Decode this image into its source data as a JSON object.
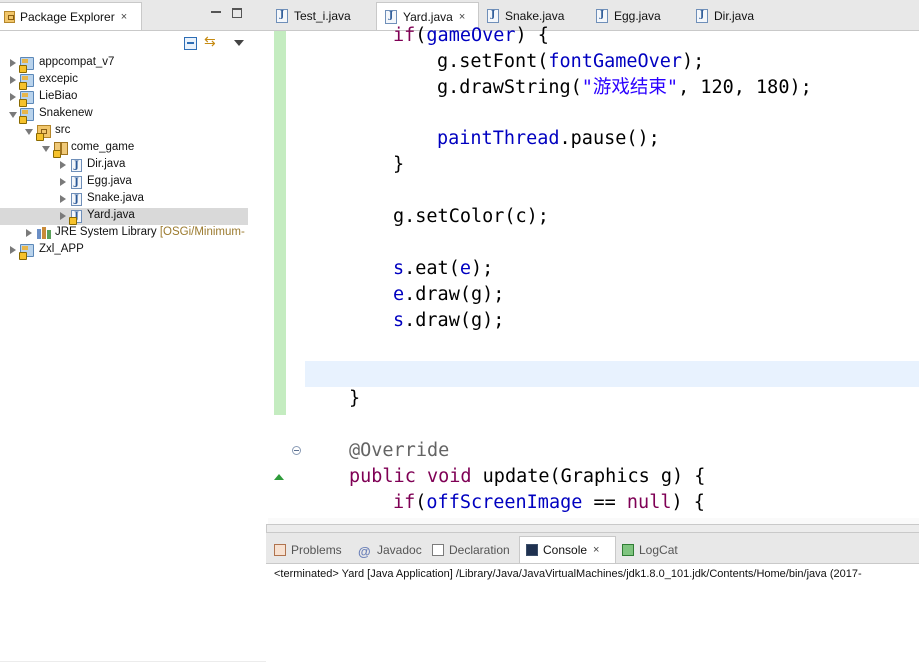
{
  "explorer": {
    "title": "Package Explorer",
    "tree": [
      {
        "label": "appcompat_v7",
        "kind": "project"
      },
      {
        "label": "excepic",
        "kind": "project"
      },
      {
        "label": "LieBiao",
        "kind": "project"
      },
      {
        "label": "Snakenew",
        "kind": "project",
        "expanded": true
      },
      {
        "label": "src",
        "kind": "source-folder",
        "expanded": true
      },
      {
        "label": "come_game",
        "kind": "package",
        "expanded": true
      },
      {
        "label": "Dir.java",
        "kind": "java"
      },
      {
        "label": "Egg.java",
        "kind": "java"
      },
      {
        "label": "Snake.java",
        "kind": "java"
      },
      {
        "label": "Yard.java",
        "kind": "java",
        "selected": true
      },
      {
        "label": "JRE System Library",
        "decoration": "[OSGi/Minimum-",
        "kind": "library"
      },
      {
        "label": "Zxl_APP",
        "kind": "project"
      }
    ]
  },
  "editor": {
    "tabs": [
      {
        "label": "Test_i.java",
        "active": false
      },
      {
        "label": "Yard.java",
        "active": true
      },
      {
        "label": "Snake.java",
        "active": false
      },
      {
        "label": "Egg.java",
        "active": false
      },
      {
        "label": "Dir.java",
        "active": false
      }
    ],
    "code": {
      "l1_kw": "if",
      "l1_p": "(",
      "l1_f": "gameOver",
      "l1_e": ") {",
      "l2_a": "g.setFont(",
      "l2_f": "fontGameOver",
      "l2_e": ");",
      "l3_a": "g.drawString(",
      "l3_s": "\"游戏结束\"",
      "l3_e": ", 120, 180);",
      "l4_f": "paintThread",
      "l4_e": ".pause();",
      "l5": "}",
      "l6": "g.setColor(c);",
      "l7_a": "s",
      "l7_b": ".eat(",
      "l7_c": "e",
      "l7_d": ");",
      "l8_a": "e",
      "l8_b": ".draw(g);",
      "l9_a": "s",
      "l9_b": ".draw(g);",
      "l10": "}",
      "l11": "@Override",
      "l12_k1": "public",
      "l12_k2": "void",
      "l12_e": " update(Graphics g) {",
      "l13_kw": "if",
      "l13_p": "(",
      "l13_f": "offScreenImage",
      "l13_m": " == ",
      "l13_n": "null",
      "l13_e": ") {"
    }
  },
  "bottom": {
    "tabs": [
      {
        "label": "Problems",
        "active": false
      },
      {
        "label": "Javadoc",
        "active": false
      },
      {
        "label": "Declaration",
        "active": false
      },
      {
        "label": "Console",
        "active": true
      },
      {
        "label": "LogCat",
        "active": false
      }
    ],
    "console_text": "<terminated> Yard [Java Application] /Library/Java/JavaVirtualMachines/jdk1.8.0_101.jdk/Contents/Home/bin/java (2017-"
  },
  "icons": {
    "tab_close": "×",
    "link_editor": "⇆"
  }
}
